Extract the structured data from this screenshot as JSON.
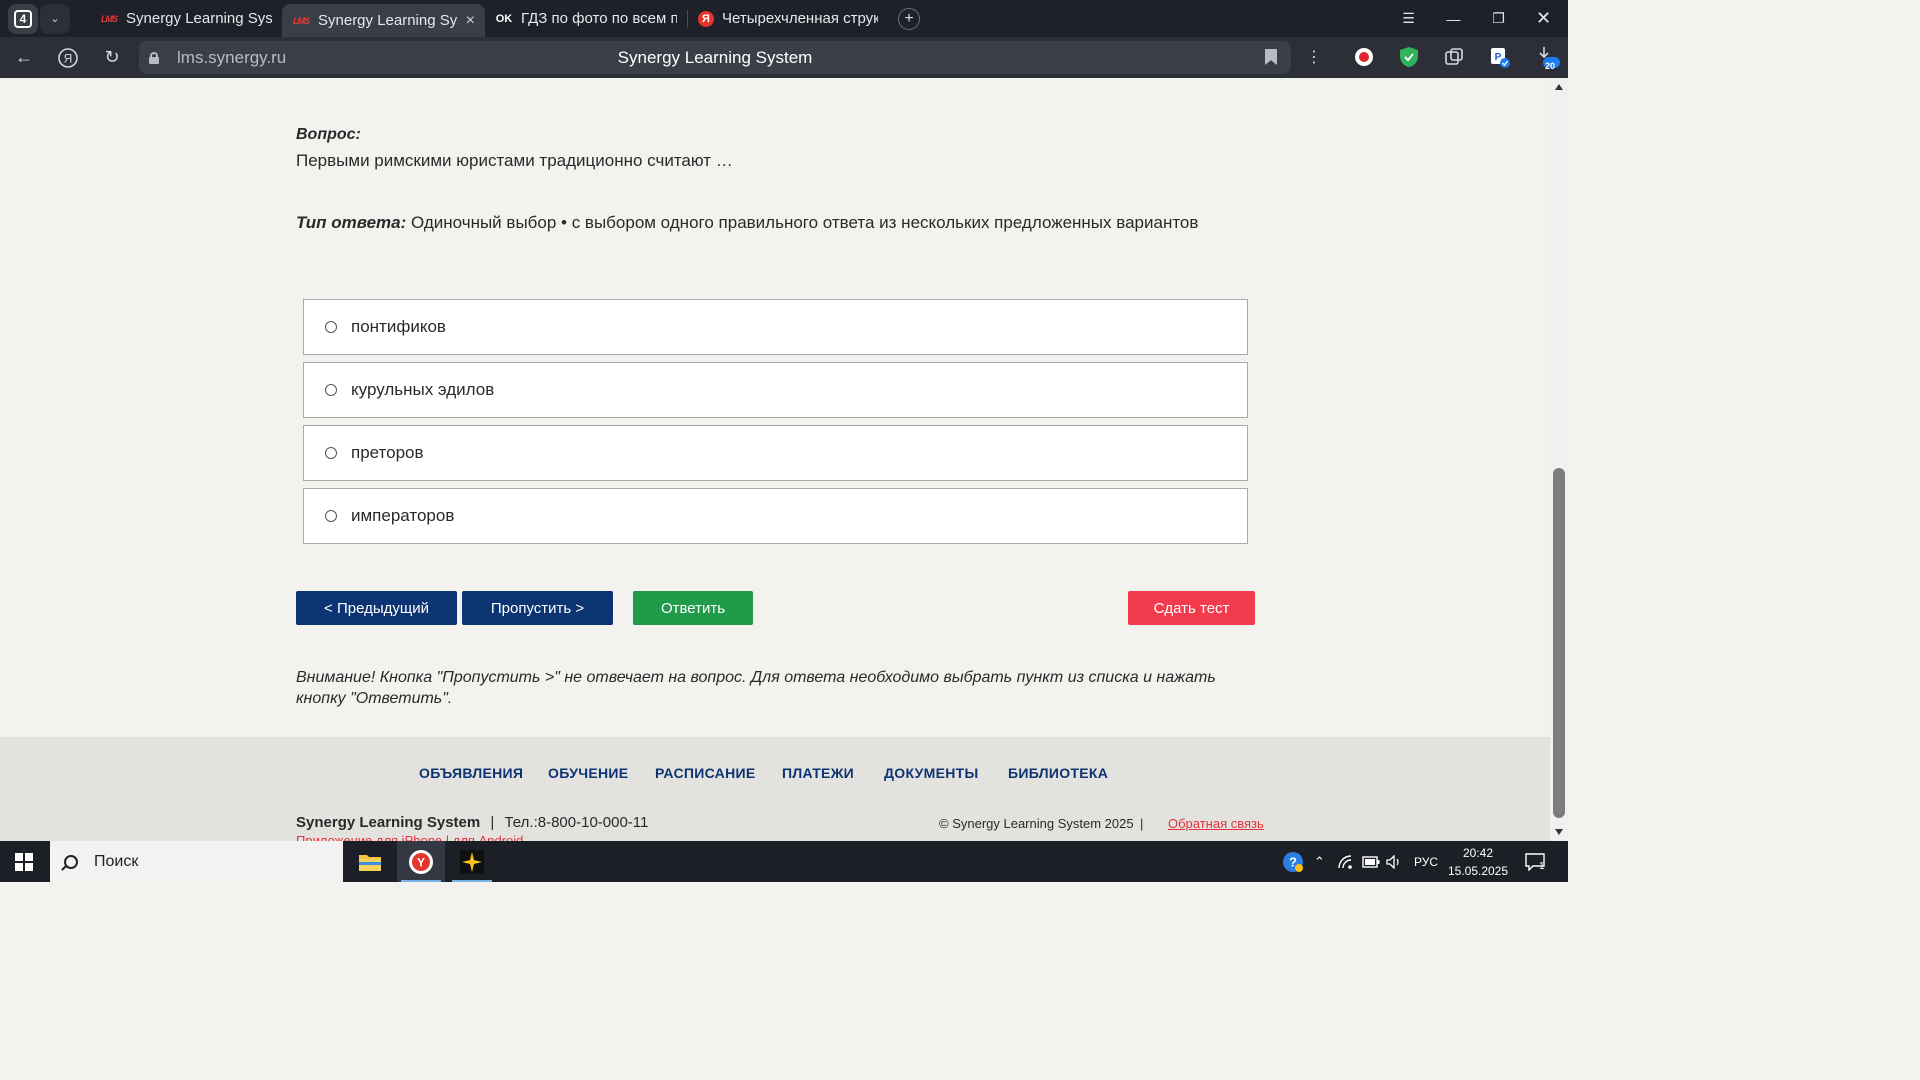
{
  "browser": {
    "tab_count": "4",
    "tabs": [
      {
        "title": "Synergy Learning System",
        "favicon": "LMS",
        "active": false
      },
      {
        "title": "Synergy Learning Syste",
        "favicon": "LMS",
        "active": true
      },
      {
        "title": "ГДЗ по фото по всем пред",
        "favicon": "OK",
        "active": false
      },
      {
        "title": "Четырехчленная структу",
        "favicon": "Я",
        "active": false
      }
    ],
    "url": "lms.synergy.ru",
    "page_title": "Synergy Learning System",
    "download_badge": "20"
  },
  "question": {
    "label": "Вопрос:",
    "text": "Первыми римскими юристами традиционно считают …",
    "answer_type_label": "Тип ответа:",
    "answer_type_value": " Одиночный выбор • с выбором одного правильного ответа из нескольких предложенных вариантов",
    "options": [
      "понтификов",
      "курульных эдилов",
      "преторов",
      "императоров"
    ]
  },
  "buttons": {
    "prev": "< Предыдущий",
    "skip": "Пропустить >",
    "answer": "Ответить",
    "submit": "Сдать тест"
  },
  "note": "Внимание! Кнопка \"Пропустить >\" не отвечает на вопрос. Для ответа необходимо выбрать пункт из списка и нажать кнопку \"Ответить\".",
  "footer": {
    "nav": [
      "ОБЪЯВЛЕНИЯ",
      "ОБУЧЕНИЕ",
      "РАСПИСАНИЕ",
      "ПЛАТЕЖИ",
      "ДОКУМЕНТЫ",
      "БИБЛИОТЕКА"
    ],
    "brand": "Synergy Learning System",
    "separator": "|",
    "phone": "Тел.:8-800-10-000-11",
    "copyright": "© Synergy Learning System 2025",
    "feedback": "Обратная связь",
    "apps_cut": "Приложение для iPhone  |  для Android"
  },
  "taskbar": {
    "search_placeholder": "Поиск",
    "language": "РУС",
    "time": "20:42",
    "date": "15.05.2025",
    "notifications": "1"
  },
  "colors": {
    "primary_button": "#0d3472",
    "answer_button": "#1f9b4a",
    "submit_button": "#f23b4d",
    "footer_nav": "#0d3472",
    "link_red": "#e0343d"
  }
}
